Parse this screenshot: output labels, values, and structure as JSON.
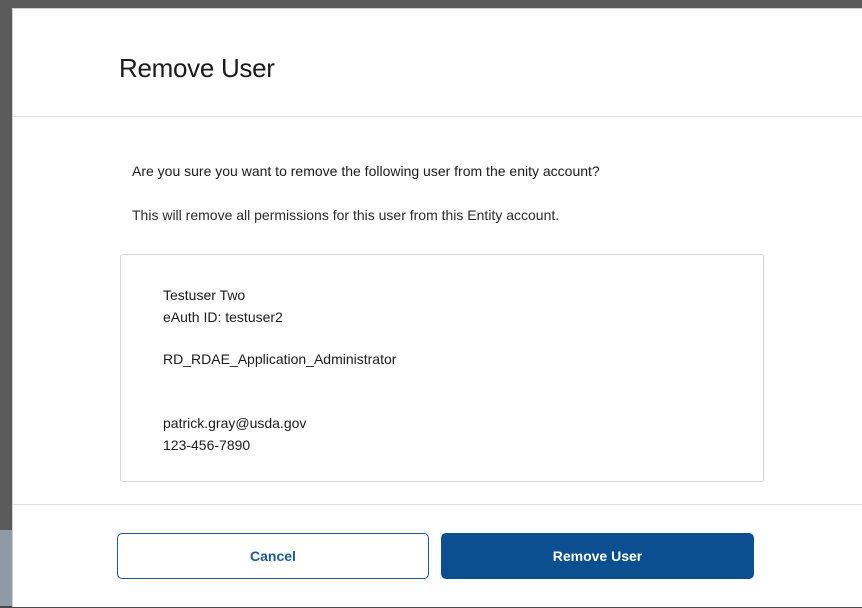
{
  "modal": {
    "title": "Remove User",
    "prompt": "Are you sure you want to remove the following user from the enity account?",
    "info": "This will remove all permissions for this user from this Entity account."
  },
  "user": {
    "name": "Testuser Two",
    "eauth_id": "eAuth ID: testuser2",
    "role": "RD_RDAE_Application_Administrator",
    "email": "patrick.gray@usda.gov",
    "phone": "123-456-7890"
  },
  "actions": {
    "cancel_label": "Cancel",
    "remove_label": "Remove User"
  },
  "colors": {
    "primary": "#0b4f91",
    "outline": "#1a5a96",
    "text": "#1b1b1b"
  }
}
